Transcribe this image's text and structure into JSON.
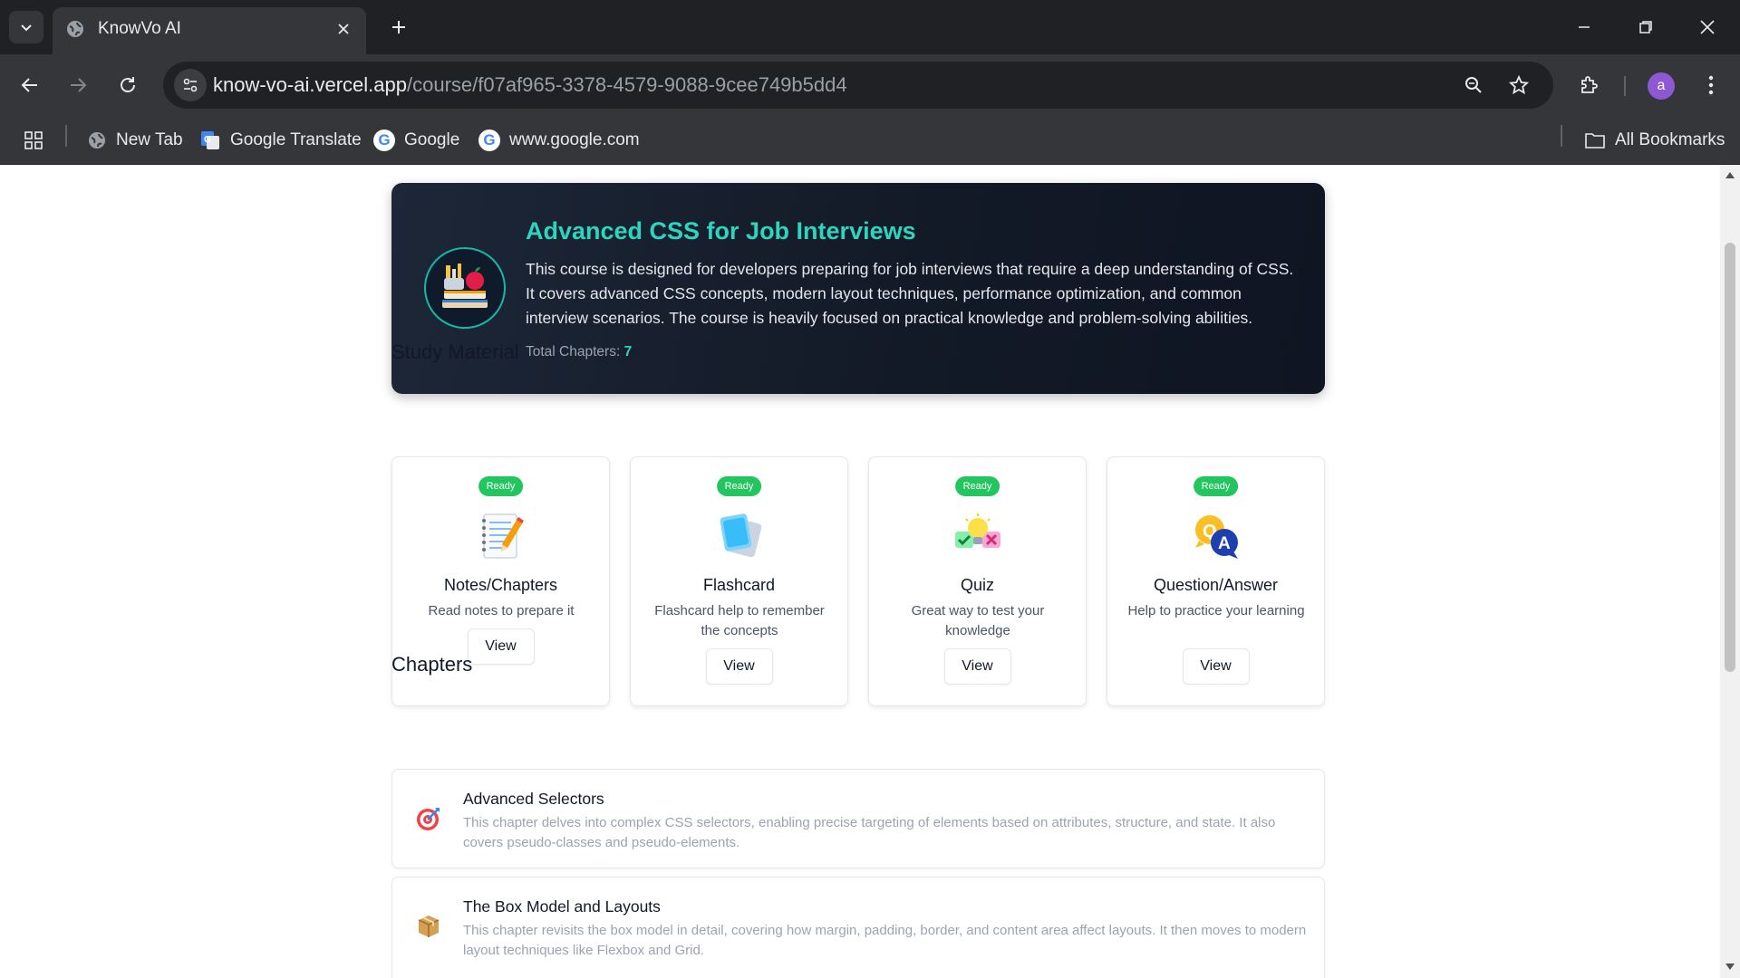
{
  "browser": {
    "tab_title": "KnowVo AI",
    "url_host": "know-vo-ai.vercel.app",
    "url_path": "/course/f07af965-3378-4579-9088-9cee749b5dd4",
    "avatar_letter": "a",
    "bookmarks": [
      {
        "label": "New Tab",
        "icon": "globe-icon"
      },
      {
        "label": "Google Translate",
        "icon": "google-translate-icon"
      },
      {
        "label": "Google",
        "icon": "google-icon"
      },
      {
        "label": "www.google.com",
        "icon": "google-icon"
      }
    ],
    "all_bookmarks_label": "All Bookmarks"
  },
  "course": {
    "title": "Advanced CSS for Job Interviews",
    "description": "This course is designed for developers preparing for job interviews that require a deep understanding of CSS. It covers advanced CSS concepts, modern layout techniques, performance optimization, and common interview scenarios. The course is heavily focused on practical knowledge and problem-solving abilities.",
    "total_chapters_label": "Total Chapters:",
    "total_chapters": "7"
  },
  "study_material": {
    "heading": "Study Material",
    "cards": [
      {
        "badge": "Ready",
        "title": "Notes/Chapters",
        "description": "Read notes to prepare it",
        "button": "View",
        "icon": "notebook-icon"
      },
      {
        "badge": "Ready",
        "title": "Flashcard",
        "description": "Flashcard help to remember the concepts",
        "button": "View",
        "icon": "flashcard-icon"
      },
      {
        "badge": "Ready",
        "title": "Quiz",
        "description": "Great way to test your knowledge",
        "button": "View",
        "icon": "quiz-icon"
      },
      {
        "badge": "Ready",
        "title": "Question/Answer",
        "description": "Help to practice your learning",
        "button": "View",
        "icon": "qa-icon"
      }
    ]
  },
  "chapters": {
    "heading": "Chapters",
    "items": [
      {
        "emoji": "🎯",
        "title": "Advanced Selectors",
        "description": "This chapter delves into complex CSS selectors, enabling precise targeting of elements based on attributes, structure, and state. It also covers pseudo-classes and pseudo-elements."
      },
      {
        "emoji": "📦",
        "title": "The Box Model and Layouts",
        "description": "This chapter revisits the box model in detail, covering how margin, padding, border, and content area affect layouts. It then moves to modern layout techniques like Flexbox and Grid."
      }
    ]
  },
  "colors": {
    "accent": "#2dd4bf",
    "ready_badge": "#22c55e",
    "hero_bg": "#131a27"
  }
}
